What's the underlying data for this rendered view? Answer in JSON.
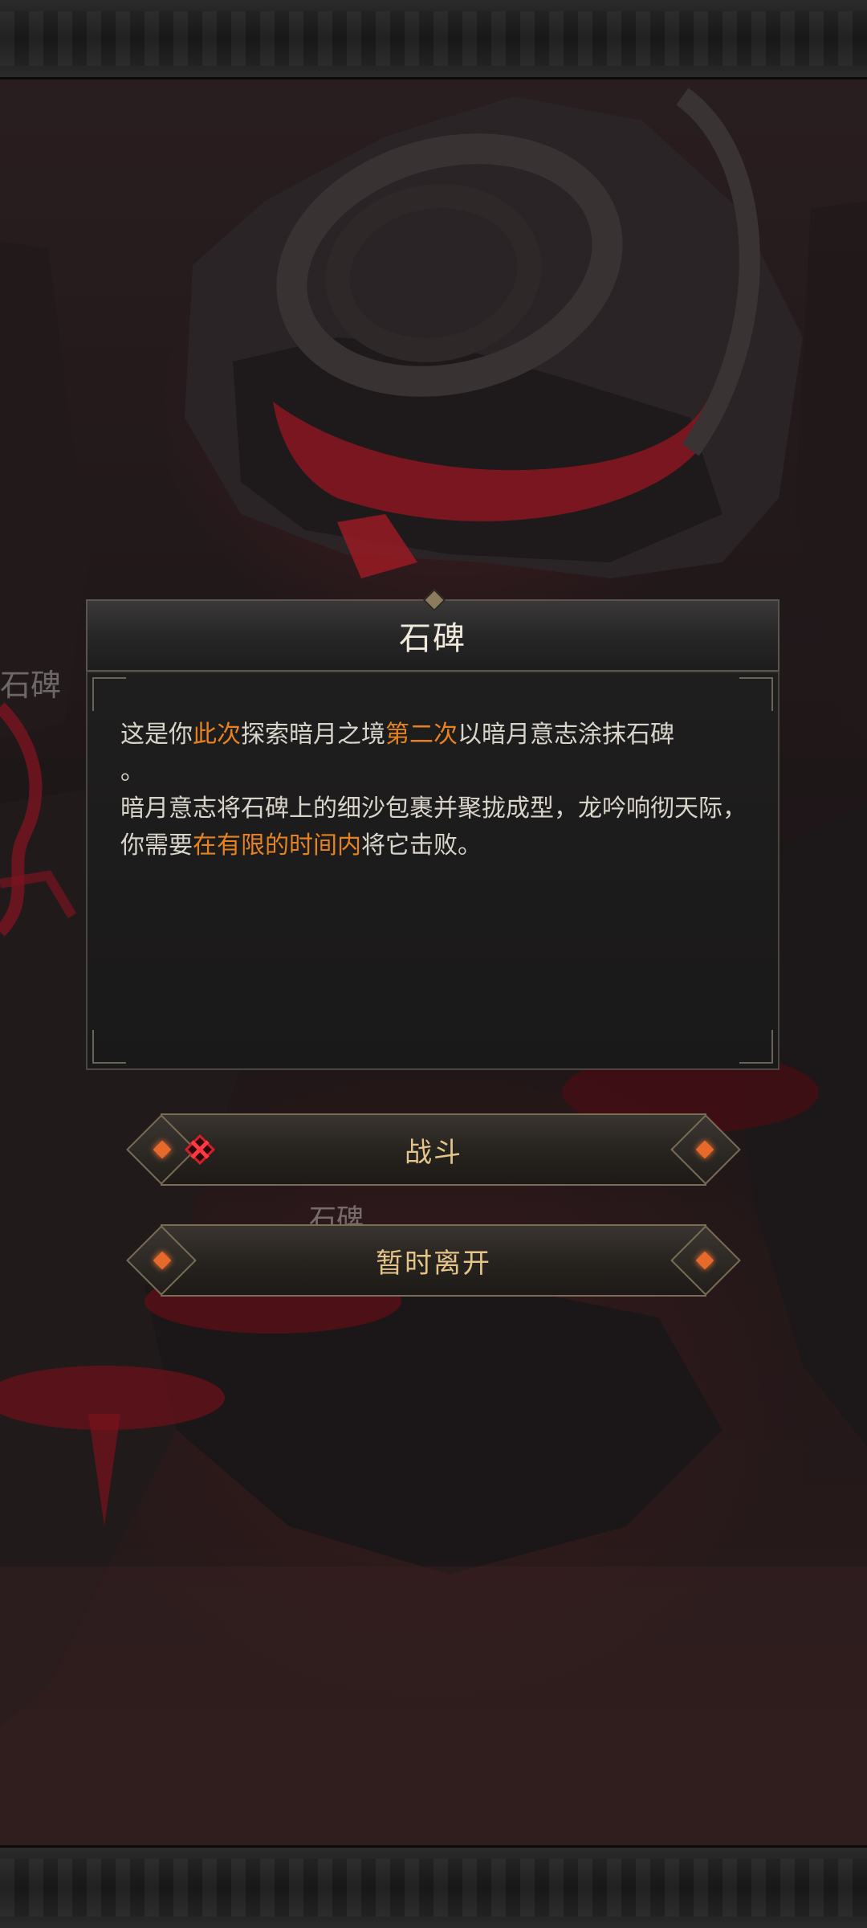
{
  "dialog": {
    "title": "石碑",
    "paragraph1": [
      {
        "text": "这是你",
        "highlight": false
      },
      {
        "text": "此次",
        "highlight": true
      },
      {
        "text": "探索暗月之境",
        "highlight": false
      },
      {
        "text": "第二次",
        "highlight": true
      },
      {
        "text": "以暗月意志涂抹石碑",
        "highlight": false
      }
    ],
    "paragraph1_end": "。",
    "paragraph2": [
      {
        "text": "暗月意志将石碑上的细沙包裹并聚拢成型，龙吟响彻天际，你需要",
        "highlight": false
      },
      {
        "text": "在有限的时间内",
        "highlight": true
      },
      {
        "text": "将它击败。",
        "highlight": false
      }
    ]
  },
  "buttons": {
    "fight_label": "战斗",
    "leave_label": "暂时离开"
  },
  "background": {
    "side_label": "石碑",
    "under_label": "石碑"
  },
  "colors": {
    "highlight": "#e6821f",
    "button_text": "#e4c489",
    "gem": "#e86a2a",
    "fight_icon": "#d0202a"
  },
  "icons": {
    "fight": "crossed-swords-icon"
  }
}
